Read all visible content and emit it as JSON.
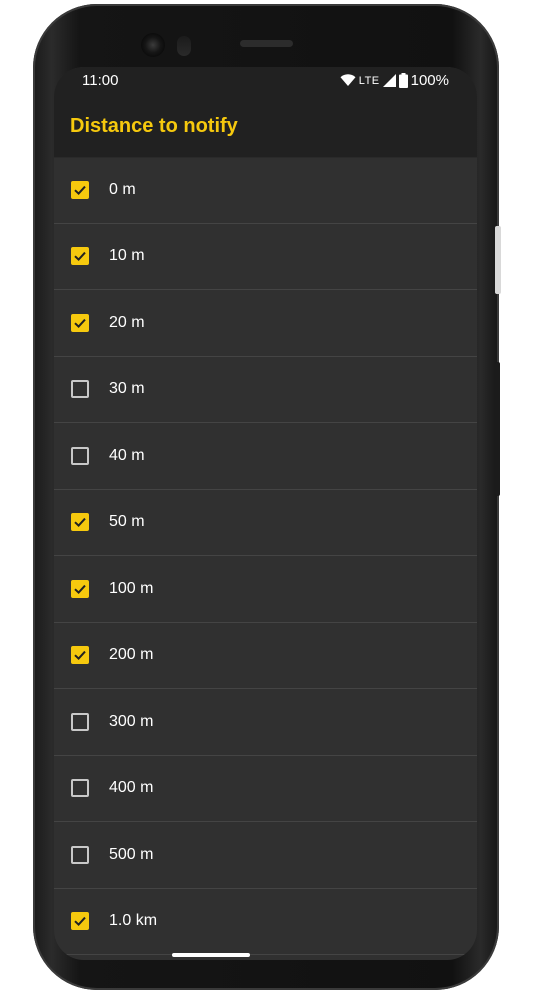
{
  "status_bar": {
    "time": "11:00",
    "network": "LTE",
    "battery": "100%"
  },
  "header": {
    "title": "Distance to notify"
  },
  "colors": {
    "accent": "#f6c90e",
    "background": "#303030",
    "bar": "#212121"
  },
  "items": [
    {
      "label": "0 m",
      "checked": true
    },
    {
      "label": "10 m",
      "checked": true
    },
    {
      "label": "20 m",
      "checked": true
    },
    {
      "label": "30 m",
      "checked": false
    },
    {
      "label": "40 m",
      "checked": false
    },
    {
      "label": "50 m",
      "checked": true
    },
    {
      "label": "100 m",
      "checked": true
    },
    {
      "label": "200 m",
      "checked": true
    },
    {
      "label": "300 m",
      "checked": false
    },
    {
      "label": "400 m",
      "checked": false
    },
    {
      "label": "500 m",
      "checked": false
    },
    {
      "label": "1.0 km",
      "checked": true
    }
  ]
}
